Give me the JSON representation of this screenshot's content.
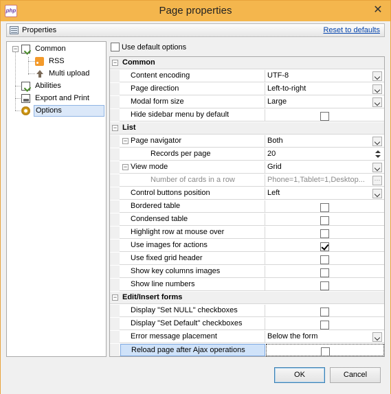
{
  "window": {
    "title": "Page properties",
    "app_icon_text": "php"
  },
  "toolbar": {
    "label": "Properties",
    "reset_link": "Reset to defaults"
  },
  "tree": {
    "items": [
      {
        "label": "Common"
      },
      {
        "label": "RSS"
      },
      {
        "label": "Multi upload"
      },
      {
        "label": "Abilities"
      },
      {
        "label": "Export and Print"
      },
      {
        "label": "Options",
        "selected": true
      }
    ]
  },
  "use_default": {
    "label": "Use default options",
    "checked": false
  },
  "grid": {
    "sections": [
      {
        "title": "Common",
        "rows": [
          {
            "name": "Content encoding",
            "value": "UTF-8",
            "editor": "dropdown"
          },
          {
            "name": "Page direction",
            "value": "Left-to-right",
            "editor": "dropdown"
          },
          {
            "name": "Modal form size",
            "value": "Large",
            "editor": "dropdown"
          },
          {
            "name": "Hide sidebar menu by default",
            "checked": false,
            "editor": "checkbox"
          }
        ]
      },
      {
        "title": "List",
        "rows": [
          {
            "name": "Page navigator",
            "value": "Both",
            "editor": "dropdown",
            "expandable": true
          },
          {
            "name": "Records per page",
            "value": "20",
            "editor": "spinner"
          },
          {
            "name": "View mode",
            "value": "Grid",
            "editor": "dropdown",
            "expandable": true
          },
          {
            "name": "Number of cards in a row",
            "value": "Phone=1,Tablet=1,Desktop...",
            "editor": "ellipsis",
            "disabled": true
          },
          {
            "name": "Control buttons position",
            "value": "Left",
            "editor": "dropdown"
          },
          {
            "name": "Bordered table",
            "checked": false,
            "editor": "checkbox"
          },
          {
            "name": "Condensed table",
            "checked": false,
            "editor": "checkbox"
          },
          {
            "name": "Highlight row at mouse over",
            "checked": false,
            "editor": "checkbox"
          },
          {
            "name": "Use images for actions",
            "checked": true,
            "editor": "checkbox"
          },
          {
            "name": "Use fixed grid header",
            "checked": false,
            "editor": "checkbox"
          },
          {
            "name": "Show key columns images",
            "checked": false,
            "editor": "checkbox"
          },
          {
            "name": "Show line numbers",
            "checked": false,
            "editor": "checkbox"
          }
        ]
      },
      {
        "title": "Edit/Insert forms",
        "rows": [
          {
            "name": "Display \"Set NULL\" checkboxes",
            "checked": false,
            "editor": "checkbox"
          },
          {
            "name": "Display \"Set Default\" checkboxes",
            "checked": false,
            "editor": "checkbox"
          },
          {
            "name": "Error message placement",
            "value": "Below the form",
            "editor": "dropdown"
          },
          {
            "name": "Reload page after Ajax operations",
            "checked": false,
            "editor": "checkbox",
            "selected": true
          }
        ]
      }
    ]
  },
  "buttons": {
    "ok": "OK",
    "cancel": "Cancel"
  },
  "colors": {
    "titlebar": "#f4b64d",
    "selection": "#cfe2f9",
    "link": "#0645ad"
  }
}
